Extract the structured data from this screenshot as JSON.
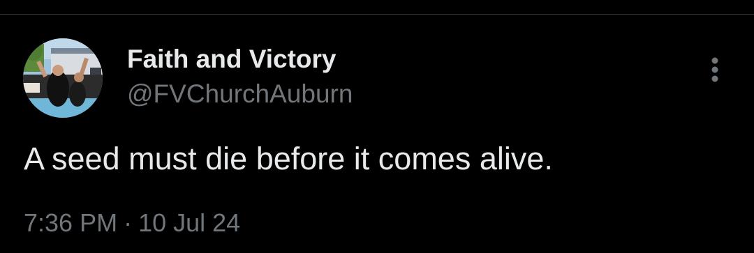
{
  "tweet": {
    "author": {
      "display_name": "Faith and Victory",
      "handle": "@FVChurchAuburn",
      "avatar_icon": "profile-photo"
    },
    "text": "A seed must die before it comes alive.",
    "timestamp": {
      "time": "7:36 PM",
      "separator": "·",
      "date": "10 Jul 24"
    },
    "more_icon": "vertical-ellipsis-icon"
  },
  "colors": {
    "background": "#000000",
    "primary_text": "#e7e9ea",
    "secondary_text": "#71767b",
    "divider": "#2f3336"
  }
}
